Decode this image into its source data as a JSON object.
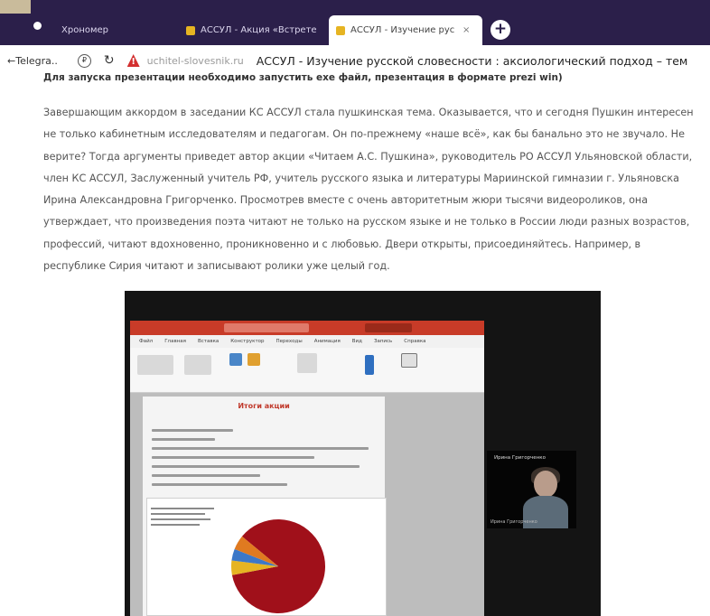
{
  "browser": {
    "tabs": [
      {
        "label": "Хрономер",
        "active": false,
        "favicon_color": "#2b1f4a"
      },
      {
        "label": "АССУЛ - Акция «Встрете",
        "active": false,
        "favicon_color": "#e6b422"
      },
      {
        "label": "АССУЛ - Изучение рус",
        "active": true,
        "favicon_color": "#e6b422"
      }
    ],
    "close_glyph": "×",
    "new_tab_glyph": "+",
    "address": {
      "back_label": "←Telegra..",
      "domain": "uchitel-slovesnik.ru",
      "page_title": "АССУЛ - Изучение русской словесности : аксиологический подход – тем"
    }
  },
  "article": {
    "cut_line": "Для запуска презентации необходимо запустить exe файл, презентация в формате prezi win)",
    "paragraph_lines": [
      "Завершающим аккордом в заседании КС АССУЛ стала пушкинская тема. Оказывается, что и сегодня Пушкин интересен",
      "не только кабинетным исследователям и педагогам. Он по-прежнему «наше всё», как бы банально это не звучало. Не",
      "верите? Тогда аргументы приведет автор акции «Читаем А.С. Пушкина», руководитель РО АССУЛ Ульяновской области,",
      "член КС АССУЛ, Заслуженный учитель РФ, учитель русского языка и литературы Мариинской гимназии г. Ульяновска",
      "Ирина Александровна Григорченко. Просмотрев вместе с очень авторитетным жюри тысячи видеороликов, она",
      "утверждает, что произведения поэта читают не только на русском языке и не только в России люди разных возрастов,",
      "профессий, читают вдохновенно, проникновенно и с любовью. Двери открыты, присоединяйтесь. Например, в",
      "республике Сирия читают и записывают ролики уже целый год."
    ]
  },
  "screenshot_photo": {
    "ppt_title": "Итоги акции",
    "ppt_menu": [
      "Файл",
      "Главная",
      "Вставка",
      "Конструктор",
      "Переходы",
      "Анимация",
      "Вид",
      "Запись",
      "Справка"
    ],
    "slide_title": "Итоги акции",
    "participant_name": "Ирина Григорченко",
    "participant_footer": "Ирина Григорченко"
  },
  "chart_data": {
    "type": "pie",
    "values": [
      86,
      5,
      4,
      5
    ],
    "colors": [
      "#a0101a",
      "#e6b422",
      "#3c78c8",
      "#e07a20"
    ]
  },
  "colors": {
    "tabbar_bg": "#2b1f4a",
    "warning_red": "#d32f2f",
    "ppt_accent": "#c83b28"
  }
}
